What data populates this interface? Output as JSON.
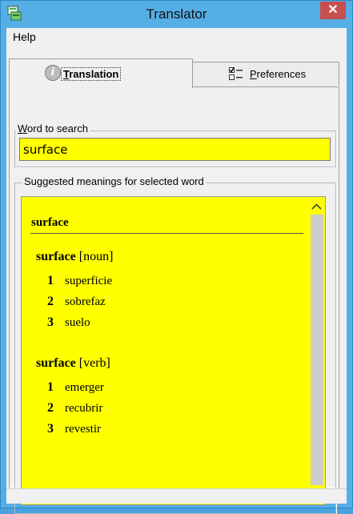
{
  "window": {
    "title": "Translator",
    "close_glyph": "✕",
    "accent": "#56aee6",
    "close_color": "#c74f4f"
  },
  "menu": {
    "help_label": "Help"
  },
  "tabs": {
    "translation": {
      "label_prefix": "",
      "accel": "T",
      "label_rest": "ranslation",
      "icon": "info-icon"
    },
    "preferences": {
      "label_prefix": "",
      "accel": "P",
      "label_rest": "references",
      "icon": "checklist-icon"
    }
  },
  "search": {
    "legend_accel": "W",
    "legend_rest": "ord to search",
    "value": "surface",
    "field_color": "#ffff00"
  },
  "meanings": {
    "legend": "Suggested meanings for selected word",
    "head_word": "surface",
    "entries": [
      {
        "word": "surface",
        "pos": "[noun]",
        "senses": [
          {
            "num": "1",
            "text": "superficie"
          },
          {
            "num": "2",
            "text": "sobrefaz"
          },
          {
            "num": "3",
            "text": "suelo"
          }
        ]
      },
      {
        "word": "surface",
        "pos": "[verb]",
        "senses": [
          {
            "num": "1",
            "text": "emerger"
          },
          {
            "num": "2",
            "text": "recubrir"
          },
          {
            "num": "3",
            "text": "revestir"
          }
        ]
      }
    ]
  }
}
